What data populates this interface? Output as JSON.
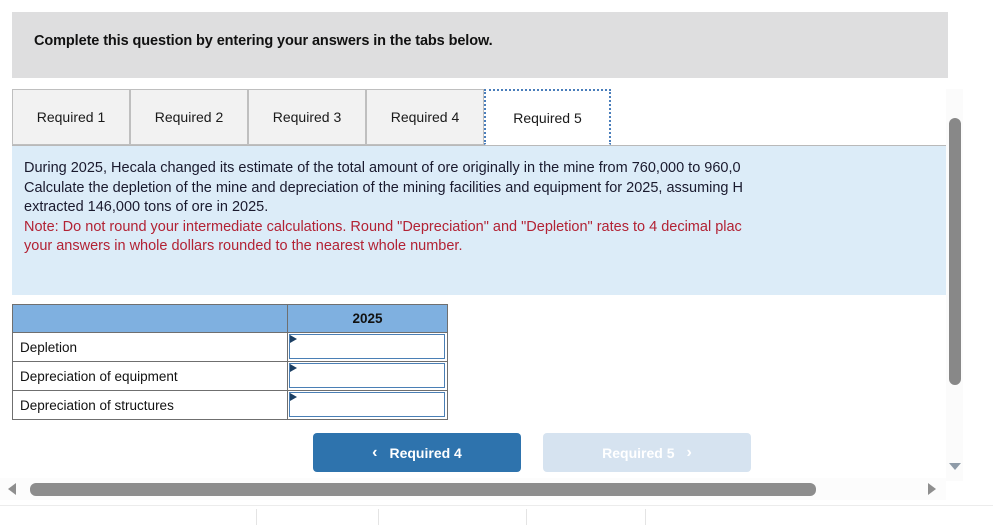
{
  "header": {
    "instruction": "Complete this question by entering your answers in the tabs below."
  },
  "tabs": [
    {
      "label": "Required 1",
      "active": false
    },
    {
      "label": "Required 2",
      "active": false
    },
    {
      "label": "Required 3",
      "active": false
    },
    {
      "label": "Required 4",
      "active": false
    },
    {
      "label": "Required 5",
      "active": true
    }
  ],
  "instructions": {
    "line1": "During 2025, Hecala changed its estimate of the total amount of ore originally in the mine from 760,000 to 960,0",
    "line2": "Calculate the depletion of the mine and depreciation of the mining facilities and equipment for 2025, assuming H",
    "line3": "extracted 146,000 tons of ore in 2025.",
    "note_line1": "Note: Do not round your intermediate calculations. Round \"Depreciation\" and \"Depletion\" rates to 4 decimal plac",
    "note_line2": "your answers in whole dollars rounded to the nearest whole number."
  },
  "table": {
    "corner_header": "",
    "year_header": "2025",
    "rows": [
      {
        "label": "Depletion",
        "value": "",
        "placeholder": ""
      },
      {
        "label": "Depreciation of equipment",
        "value": "",
        "placeholder": ""
      },
      {
        "label": "Depreciation of structures",
        "value": "",
        "placeholder": ""
      }
    ]
  },
  "navigation": {
    "prev_label": "Required 4",
    "prev_chevron": "‹",
    "next_label": "Required 5",
    "next_chevron": "›"
  },
  "colors": {
    "header_bar": "#dededf",
    "instruction_panel": "#dcecf8",
    "note_text": "#b22234",
    "table_header": "#7fb0e0",
    "prev_button": "#2e73ad",
    "next_button_disabled": "#d6e3f0",
    "input_border": "#4a7fb5",
    "scrollbar_thumb": "#8d8d8d"
  }
}
